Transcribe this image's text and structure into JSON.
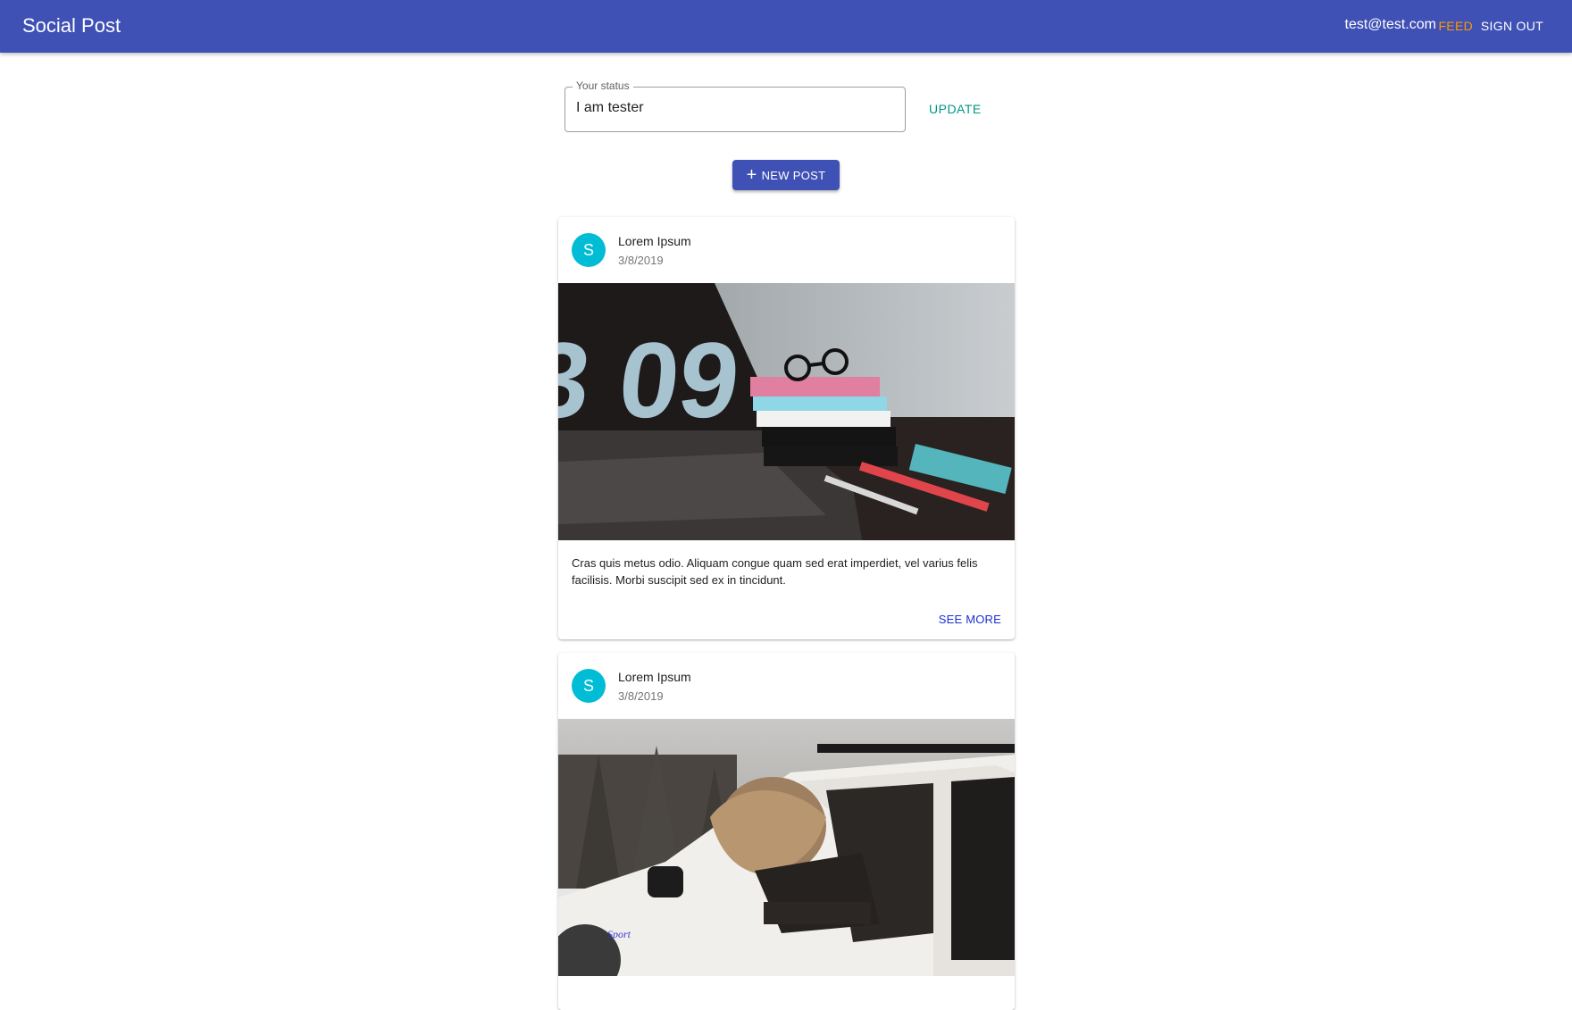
{
  "appbar": {
    "title": "Social Post",
    "email": "test@test.com",
    "feed_label": "FEED",
    "signout_label": "SIGN OUT"
  },
  "status": {
    "label": "Your status",
    "value": "I am tester",
    "update_label": "UPDATE"
  },
  "new_post": {
    "label": "NEW POST",
    "icon": "plus-icon"
  },
  "posts": [
    {
      "avatar_letter": "S",
      "author": "Lorem Ipsum",
      "date": "3/8/2019",
      "image": "laptop-books-photo",
      "text": "Cras quis metus odio. Aliquam congue quam sed erat imperdiet, vel varius felis facilisis. Morbi suscipit sed ex in tincidunt.",
      "see_more_label": "SEE MORE"
    },
    {
      "avatar_letter": "S",
      "author": "Lorem Ipsum",
      "date": "3/8/2019",
      "image": "woman-car-window-photo"
    }
  ],
  "colors": {
    "primary": "#3f51b5",
    "accent_feed": "#ff9800",
    "update": "#009688",
    "avatar": "#00bcd4",
    "link": "#1a2fd6"
  }
}
